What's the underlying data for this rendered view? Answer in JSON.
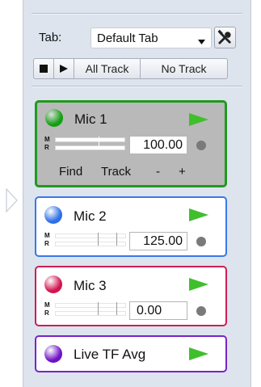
{
  "tab_bar": {
    "label": "Tab:",
    "selected": "Default Tab",
    "caret": "▾",
    "tools_icon": "tools-icon"
  },
  "transport": {
    "stop_icon": "stop-icon",
    "play_icon": "play-icon",
    "all_track_label": "All Track",
    "no_track_label": "No Track"
  },
  "tracks": [
    {
      "name": "Mic 1",
      "value": "100.00",
      "dot_color": "#12a012",
      "border_color": "#1f9a1f",
      "play_color": "#3fbf2c",
      "selected": true,
      "meter_m": "M",
      "meter_r": "R",
      "actions": {
        "find": "Find",
        "track": "Track",
        "minus": "-",
        "plus": "+"
      }
    },
    {
      "name": "Mic 2",
      "value": "125.00",
      "dot_color": "#2d6fe6",
      "border_color": "#3a78e8",
      "play_color": "#3fbf2c",
      "selected": false,
      "meter_m": "M",
      "meter_r": "R"
    },
    {
      "name": "Mic 3",
      "value": "0.00",
      "dot_color": "#d3134f",
      "border_color": "#cc1f55",
      "play_color": "#3fbf2c",
      "selected": false,
      "meter_m": "M",
      "meter_r": "R"
    },
    {
      "name": "Live TF Avg",
      "dot_color": "#6f12c7",
      "border_color": "#7a22c9",
      "play_color": "#3fbf2c",
      "selected": false
    }
  ]
}
